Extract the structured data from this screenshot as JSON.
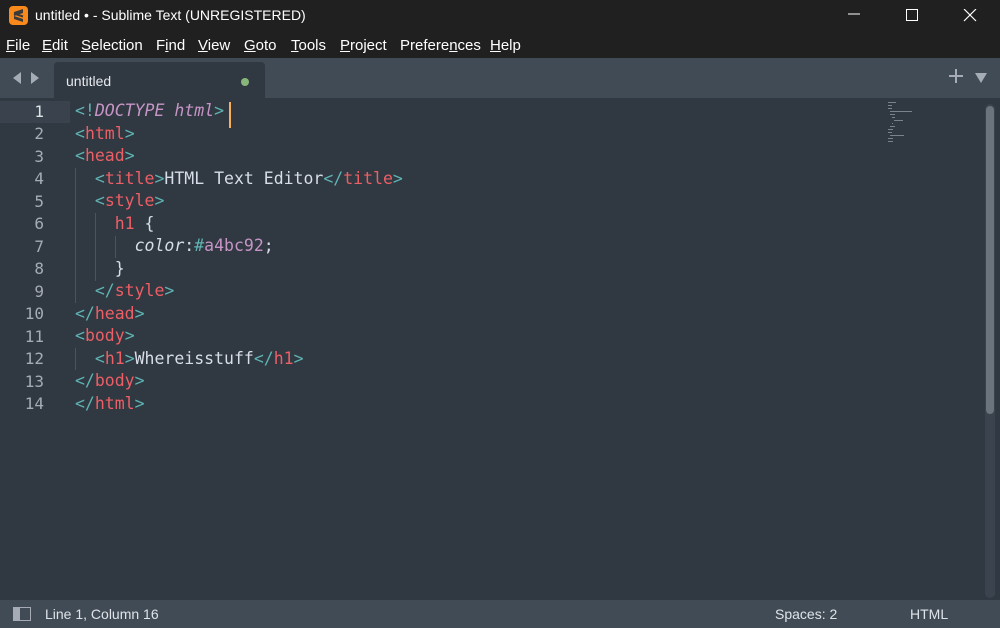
{
  "window": {
    "title": "untitled • - Sublime Text (UNREGISTERED)"
  },
  "menu": [
    {
      "pre": "",
      "u": "F",
      "post": "ile"
    },
    {
      "pre": "",
      "u": "E",
      "post": "dit"
    },
    {
      "pre": "",
      "u": "S",
      "post": "election"
    },
    {
      "pre": "F",
      "u": "i",
      "post": "nd"
    },
    {
      "pre": "",
      "u": "V",
      "post": "iew"
    },
    {
      "pre": "",
      "u": "G",
      "post": "oto"
    },
    {
      "pre": "",
      "u": "T",
      "post": "ools"
    },
    {
      "pre": "",
      "u": "P",
      "post": "roject"
    },
    {
      "pre": "Prefere",
      "u": "n",
      "post": "ces"
    },
    {
      "pre": "",
      "u": "H",
      "post": "elp"
    }
  ],
  "tabs": [
    {
      "label": "untitled",
      "dirty": true
    }
  ],
  "editor": {
    "line_numbers": [
      "1",
      "2",
      "3",
      "4",
      "5",
      "6",
      "7",
      "8",
      "9",
      "10",
      "11",
      "12",
      "13",
      "14"
    ],
    "active_line": 1,
    "lines": [
      "<!DOCTYPE html>",
      "<html>",
      "<head>",
      "  <title>HTML Text Editor</title>",
      "  <style>",
      "    h1 {",
      "      color:#a4bc92;",
      "    }",
      "  </style>",
      "</head>",
      "<body>",
      "  <h1>Whereisstuff</h1>",
      "</body>",
      "</html>"
    ]
  },
  "status": {
    "position": "Line 1, Column 16",
    "indent": "Spaces: 2",
    "syntax": "HTML"
  },
  "colors": {
    "background": "#303841",
    "tag": "#ec5f66",
    "punctuation": "#5fb4b4",
    "keyword": "#c695c6",
    "caret": "#f9ae58",
    "dirty_dot": "#88b67a"
  },
  "icons": {
    "app": "sublime-text-logo-icon",
    "minimize": "minimize-icon",
    "maximize": "maximize-icon",
    "close": "close-icon",
    "back": "arrow-left-icon",
    "forward": "arrow-right-icon",
    "new_tab": "plus-icon",
    "tab_menu": "triangle-down-icon",
    "sidebar": "sidebar-toggle-icon"
  }
}
